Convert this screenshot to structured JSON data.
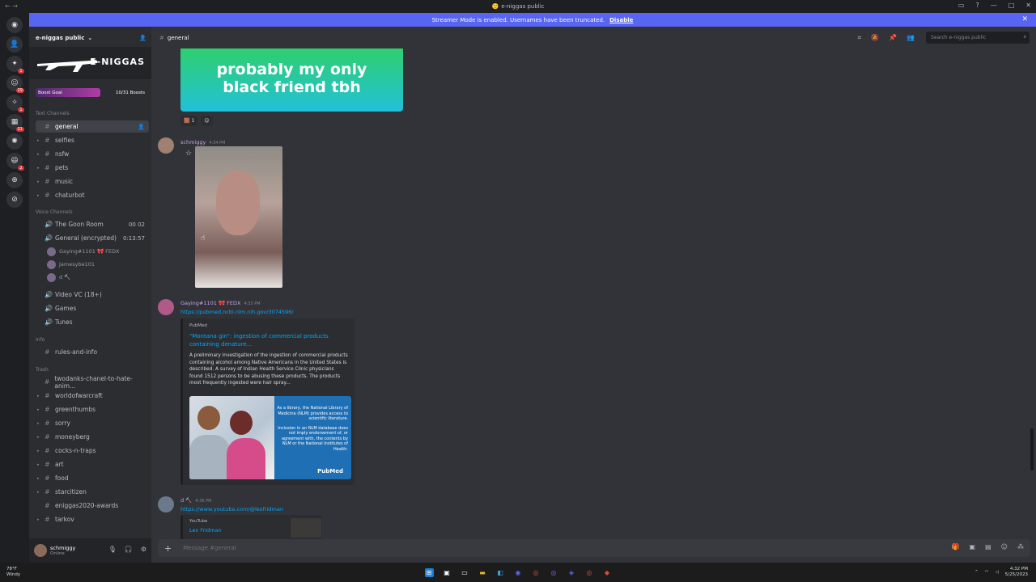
{
  "window": {
    "title": "e-niggas public",
    "title_icon": "🙂"
  },
  "banner": {
    "text": "Streamer Mode is enabled. Usernames have been truncated.",
    "disable": "Disable"
  },
  "servers": [
    {
      "icon": "discord-home-icon",
      "glyph": "◉",
      "badge": ""
    },
    {
      "icon": "server-avatar",
      "glyph": "👤",
      "badge": ""
    },
    {
      "icon": "server-icon",
      "glyph": "✦",
      "badge": "1"
    },
    {
      "icon": "server-icon",
      "glyph": "☺",
      "badge": "29"
    },
    {
      "icon": "server-icon",
      "glyph": "✧",
      "badge": "1"
    },
    {
      "icon": "server-icon",
      "glyph": "▦",
      "badge": "21"
    },
    {
      "icon": "server-icon",
      "glyph": "✺",
      "badge": ""
    },
    {
      "icon": "server-icon",
      "glyph": "😃",
      "badge": "2"
    },
    {
      "icon": "add-server-icon",
      "glyph": "⊕",
      "badge": ""
    },
    {
      "icon": "discover-icon",
      "glyph": "⊘",
      "badge": ""
    }
  ],
  "server": {
    "name": "e-niggas public",
    "banner_text": "E-NIGGAS",
    "boost_goal": "Boost Goal",
    "boost_count": "10/31 Boosts"
  },
  "categories": {
    "text": "Text Channels",
    "voice": "Voice Channels",
    "info": "Info",
    "trash": "Trash"
  },
  "text_channels": [
    "general",
    "selfies",
    "nsfw",
    "pets",
    "music",
    "chaturbot"
  ],
  "voice_channels": [
    {
      "name": "The Goon Room",
      "trail": "00 02"
    },
    {
      "name": "General (encrypted)",
      "trail": "0:13:57"
    }
  ],
  "voice_users": [
    "Gaying#1101 🎀 FEDX",
    "Jamesybe101",
    "d 🔨"
  ],
  "voice_channels_2": [
    "Video VC (18+)",
    "Games",
    "Tunes"
  ],
  "info_channels": [
    "rules-and-info"
  ],
  "trash_channels": [
    "twodanks-chanel-to-hate-anim...",
    "worldofwarcraft",
    "greenthumbs",
    "sorry",
    "moneyberg",
    "cocks-n-traps",
    "art",
    "food",
    "starcitizen",
    "eniggas2020-awards",
    "tarkov"
  ],
  "user": {
    "name": "schmiggy",
    "status": "Online"
  },
  "header": {
    "channel": "general",
    "search_placeholder": "Search e-niggas public"
  },
  "messages": {
    "gif_text": "probably my only black friend tbh",
    "reaction_count": "1",
    "m1_author": "schmiggy",
    "m1_time": "4:34 PM",
    "m2_author": "Gaying#1101 🎀 FEDX",
    "m2_time": "4:35 PM",
    "m2_link": "https://pubmed.ncbi.nlm.nih.gov/3074596/",
    "embed_provider": "PubMed",
    "embed_title": "\"Montana gin\": ingestion of commercial products containing denature...",
    "embed_desc": "A preliminary investigation of the ingestion of commercial products containing alcohol among Native Americans in the United States is described. A survey of Indian Health Service Clinic physicians found 1512 persons to be abusing these products. The products most frequently ingested were hair spray...",
    "embed_img_text1": "As a library, the National Library of Medicine (NLM) provides access to scientific literature.",
    "embed_img_text2": "Inclusion in an NLM database does not imply endorsement of, or agreement with, the contents by NLM or the National Institutes of Health.",
    "embed_img_brand": "PubMed",
    "m3_author": "d 🔨",
    "m3_time": "4:36 PM",
    "m3_link": "https://www.youtube.com/@lexfridman",
    "yt_provider": "YouTube",
    "yt_title": "Lex Fridman"
  },
  "composer": {
    "placeholder": "Message #general"
  },
  "taskbar": {
    "weather_temp": "78°F",
    "weather_desc": "Windy",
    "time": "4:32 PM",
    "date": "5/25/2023"
  }
}
